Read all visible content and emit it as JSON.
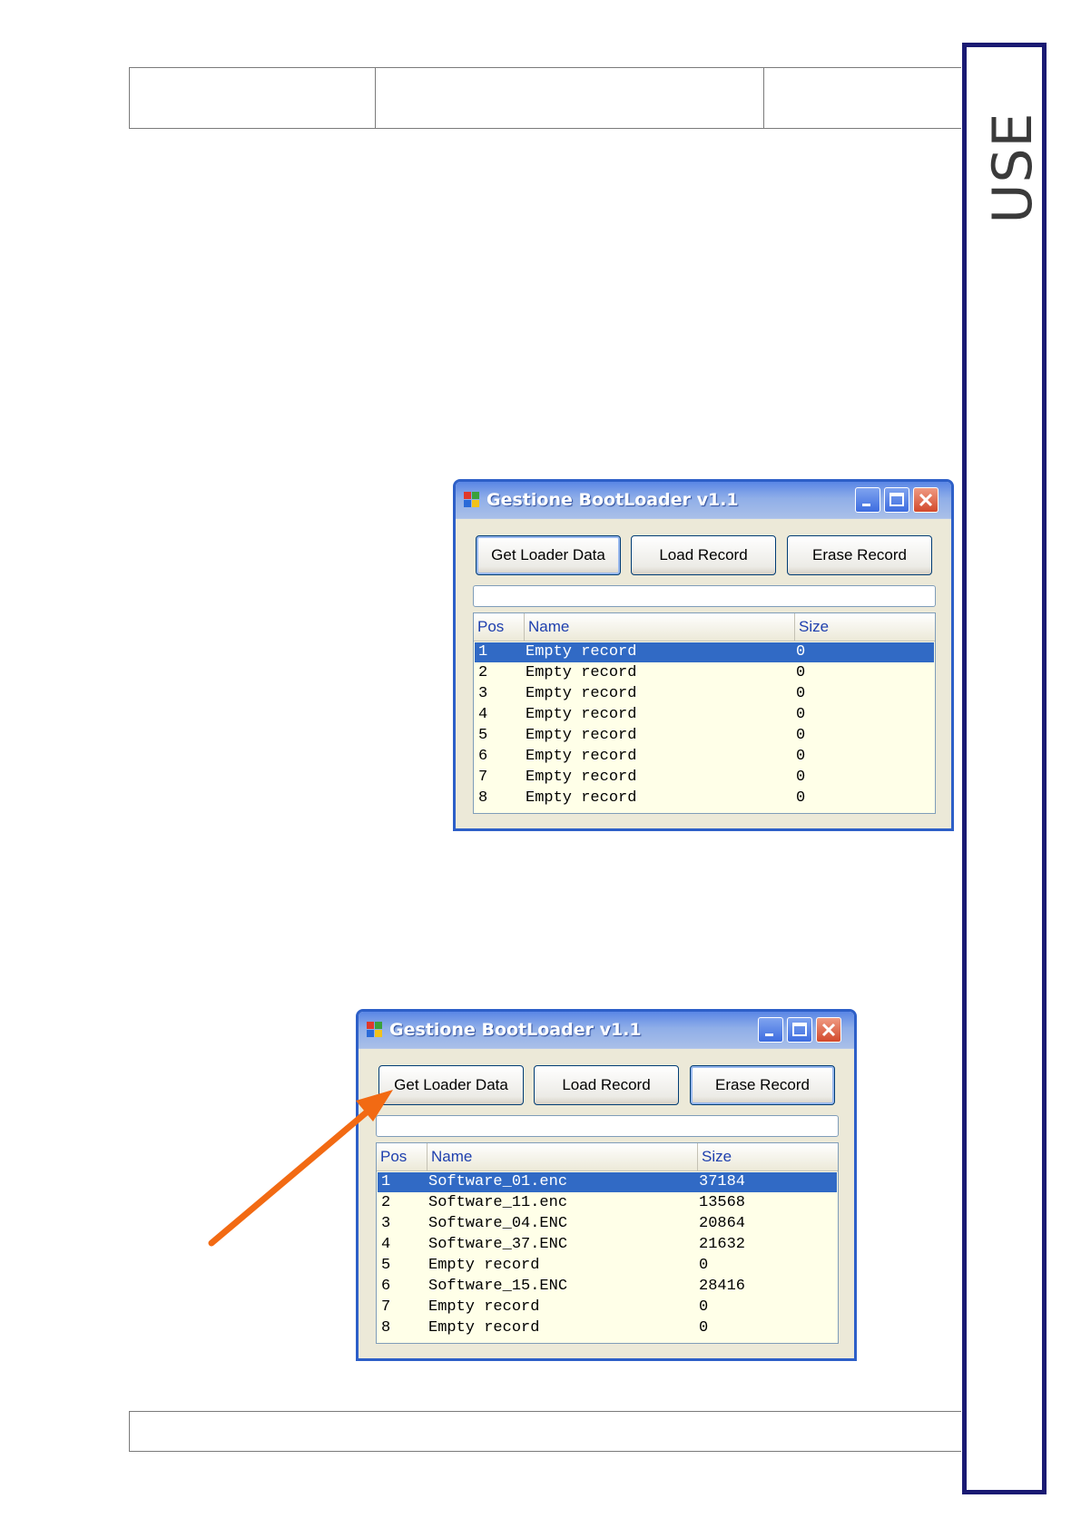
{
  "side_tab": {
    "label": "USE"
  },
  "windows": [
    {
      "title": "Gestione BootLoader v1.1",
      "buttons": {
        "get": "Get Loader Data",
        "load": "Load Record",
        "erase": "Erase Record"
      },
      "columns": {
        "pos": "Pos",
        "name": "Name",
        "size": "Size"
      },
      "rows": [
        {
          "pos": "1",
          "name": "Empty record",
          "size": "0",
          "selected": true
        },
        {
          "pos": "2",
          "name": "Empty record",
          "size": "0"
        },
        {
          "pos": "3",
          "name": "Empty record",
          "size": "0"
        },
        {
          "pos": "4",
          "name": "Empty record",
          "size": "0"
        },
        {
          "pos": "5",
          "name": "Empty record",
          "size": "0"
        },
        {
          "pos": "6",
          "name": "Empty record",
          "size": "0"
        },
        {
          "pos": "7",
          "name": "Empty record",
          "size": "0"
        },
        {
          "pos": "8",
          "name": "Empty record",
          "size": "0"
        }
      ]
    },
    {
      "title": "Gestione BootLoader v1.1",
      "buttons": {
        "get": "Get Loader Data",
        "load": "Load Record",
        "erase": "Erase Record"
      },
      "columns": {
        "pos": "Pos",
        "name": "Name",
        "size": "Size"
      },
      "rows": [
        {
          "pos": "1",
          "name": "Software_01.enc",
          "size": "37184",
          "selected": true
        },
        {
          "pos": "2",
          "name": "Software_11.enc",
          "size": "13568"
        },
        {
          "pos": "3",
          "name": "Software_04.ENC",
          "size": "20864"
        },
        {
          "pos": "4",
          "name": "Software_37.ENC",
          "size": "21632"
        },
        {
          "pos": "5",
          "name": "Empty record",
          "size": "0"
        },
        {
          "pos": "6",
          "name": "Software_15.ENC",
          "size": "28416"
        },
        {
          "pos": "7",
          "name": "Empty record",
          "size": "0"
        },
        {
          "pos": "8",
          "name": "Empty record",
          "size": "0"
        }
      ]
    }
  ],
  "colors": {
    "arrow": "#f26a13",
    "side_border": "#1a1a73",
    "selection": "#316ac5",
    "list_bg": "#ffffe8"
  }
}
